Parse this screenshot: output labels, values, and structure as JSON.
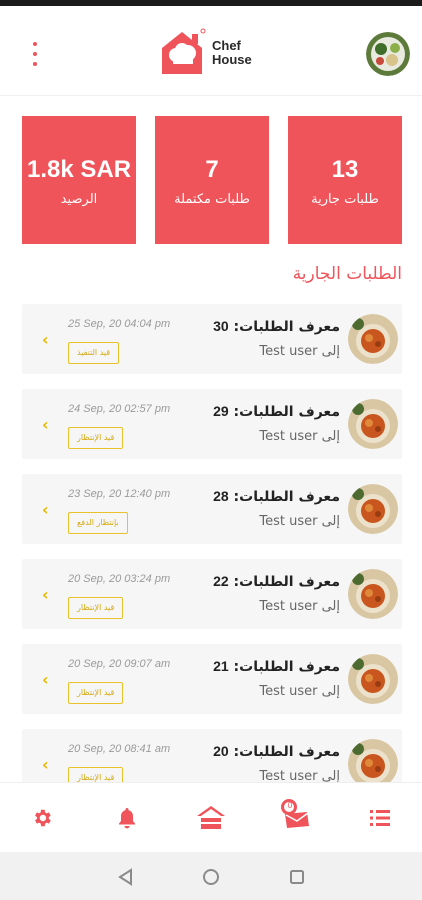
{
  "header": {
    "logo_line1": "Chef",
    "logo_line2": "House",
    "menu_icon": "kebab-menu-icon",
    "avatar": "user-avatar"
  },
  "stats": {
    "balance": {
      "value": "1.8k SAR",
      "label": "الرصيد"
    },
    "completed": {
      "value": "7",
      "label": "طلبات مكتملة"
    },
    "ongoing": {
      "value": "13",
      "label": "طلبات جارية"
    }
  },
  "section_title": "الطلبات الجارية",
  "orders": [
    {
      "title_label": "معرف الطلبات:",
      "number": "30",
      "to": "إلى Test user",
      "date": "25 Sep, 20 04:04 pm",
      "status": "قيد التنفيذ"
    },
    {
      "title_label": "معرف الطلبات:",
      "number": "29",
      "to": "إلى Test user",
      "date": "24 Sep, 20 02:57 pm",
      "status": "قيد الإنتظار"
    },
    {
      "title_label": "معرف الطلبات:",
      "number": "28",
      "to": "إلى Test user",
      "date": "23 Sep, 20 12:40 pm",
      "status": "بإنتظار الدفع"
    },
    {
      "title_label": "معرف الطلبات:",
      "number": "22",
      "to": "إلى Test user",
      "date": "20 Sep, 20 03:24 pm",
      "status": "قيد الإنتظار"
    },
    {
      "title_label": "معرف الطلبات:",
      "number": "21",
      "to": "إلى Test user",
      "date": "20 Sep, 20 09:07 am",
      "status": "قيد الإنتظار"
    },
    {
      "title_label": "معرف الطلبات:",
      "number": "20",
      "to": "إلى Test user",
      "date": "20 Sep, 20 08:41 am",
      "status": "قيد الإنتظار"
    }
  ],
  "bottom_nav": {
    "items": [
      "settings-icon",
      "bell-icon",
      "home-icon",
      "messages-icon",
      "list-icon"
    ],
    "messages_badge": "0"
  },
  "colors": {
    "accent": "#f0545b",
    "status_yellow": "#e6b800",
    "card_bg": "#f6f6f6"
  }
}
